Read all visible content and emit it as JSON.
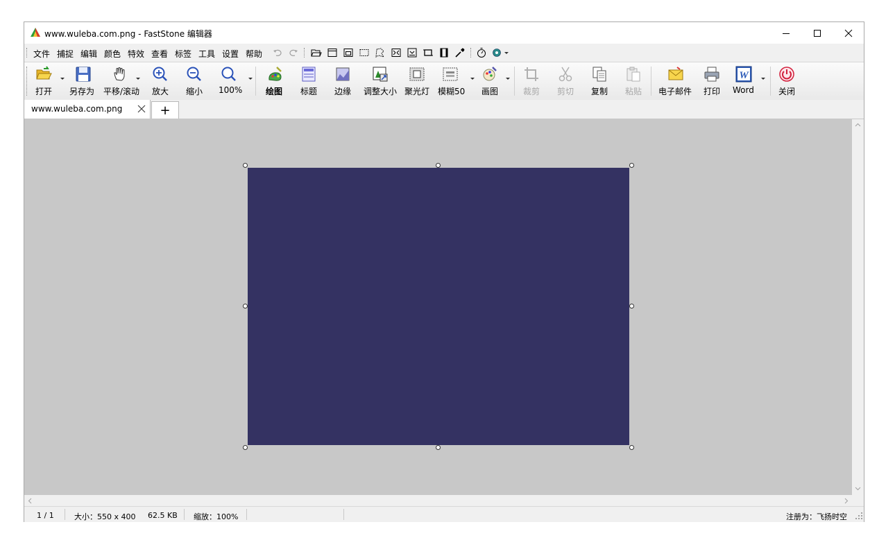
{
  "window": {
    "title": "www.wuleba.com.png - FastStone 编辑器",
    "controls": [
      "minimize-icon",
      "maximize-icon",
      "close-icon"
    ]
  },
  "menu": {
    "items": [
      "文件",
      "捕捉",
      "编辑",
      "颜色",
      "特效",
      "查看",
      "标签",
      "工具",
      "设置",
      "帮助"
    ],
    "quick_tools": [
      "undo-icon",
      "redo-icon",
      "open-folder-icon",
      "window-capture-icon",
      "object-capture-icon",
      "rect-capture-icon",
      "freehand-capture-icon",
      "fullscreen-capture-icon",
      "scroll-capture-icon",
      "fixed-region-icon",
      "video-capture-icon",
      "color-picker-icon",
      "timer-icon",
      "settings-gear-icon"
    ]
  },
  "toolbar": {
    "buttons": [
      {
        "label": "打开",
        "icon": "open-folder-icon"
      },
      {
        "label": "另存为",
        "icon": "save-floppy-icon"
      },
      {
        "label": "平移/滚动",
        "icon": "hand-pan-icon"
      },
      {
        "label": "放大",
        "icon": "zoom-in-icon"
      },
      {
        "label": "缩小",
        "icon": "zoom-out-icon"
      },
      {
        "label": "100%",
        "icon": "zoom-100-icon"
      },
      {
        "label": "绘图",
        "icon": "draw-icon"
      },
      {
        "label": "标题",
        "icon": "caption-icon"
      },
      {
        "label": "边缘",
        "icon": "edge-icon"
      },
      {
        "label": "调整大小",
        "icon": "resize-icon"
      },
      {
        "label": "聚光灯",
        "icon": "spotlight-icon"
      },
      {
        "label": "模糊50",
        "icon": "blur-icon"
      },
      {
        "label": "画图",
        "icon": "paint-icon"
      },
      {
        "label": "裁剪",
        "icon": "crop-icon"
      },
      {
        "label": "剪切",
        "icon": "cut-scissors-icon"
      },
      {
        "label": "复制",
        "icon": "copy-icon"
      },
      {
        "label": "粘贴",
        "icon": "paste-icon"
      },
      {
        "label": "电子邮件",
        "icon": "email-icon"
      },
      {
        "label": "打印",
        "icon": "printer-icon"
      },
      {
        "label": "Word",
        "icon": "word-icon"
      },
      {
        "label": "关闭",
        "icon": "power-icon"
      }
    ]
  },
  "tabs": {
    "active": "www.wuleba.com.png",
    "add_label": "+"
  },
  "image": {
    "fill_color": "#343262"
  },
  "status": {
    "page": "1 / 1",
    "size": "大小：550 x 400",
    "filesize": "62.5 KB",
    "zoom": "缩放：100%",
    "registered": "注册为：飞扬时空"
  }
}
